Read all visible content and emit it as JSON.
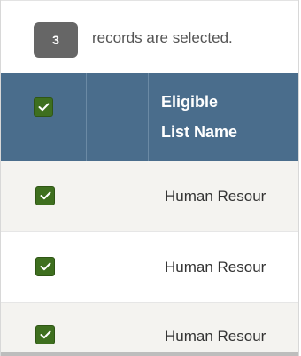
{
  "selection": {
    "count": "3",
    "message": "records are selected."
  },
  "grid": {
    "columns": {
      "select": "",
      "blank": "",
      "eligible_list_name_line1": "Eligible",
      "eligible_list_name_line2": "List Name"
    },
    "rows": [
      {
        "checked": true,
        "name": "Human Resour"
      },
      {
        "checked": true,
        "name": "Human Resour"
      },
      {
        "checked": true,
        "name": "Human Resour"
      }
    ]
  },
  "colors": {
    "header_bg": "#4a6d8c",
    "checkbox_green": "#3e6f1f",
    "badge_gray": "#666666",
    "row_alt": "#f4f3f0"
  }
}
